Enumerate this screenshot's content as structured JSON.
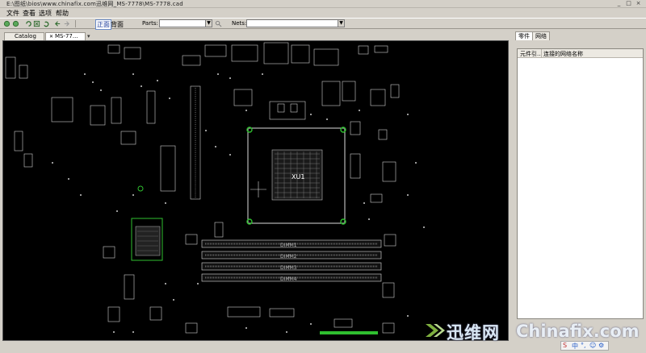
{
  "window": {
    "title": "E:\\图纸\\bios\\www.chinafix.com迅维网_MS-7778\\MS-7778.cad",
    "controls": [
      "_",
      "□",
      "×"
    ]
  },
  "menu": [
    "文件",
    "查看",
    "选项",
    "帮助"
  ],
  "toolbar": {
    "mode_active": "正面",
    "mode_other": "背面",
    "parts_label": "Parts:",
    "parts_value": "",
    "nets_label": "Nets:",
    "nets_value": ""
  },
  "tabs": [
    {
      "label": "Catalog",
      "active": false
    },
    {
      "label": "MS-77...",
      "active": true
    }
  ],
  "canvas": {
    "background": "#000000",
    "dimm_labels": [
      "DIMM1",
      "DIMM2",
      "DIMM3",
      "DIMM4"
    ],
    "cpu_label": "XU1",
    "pcb_outline_color": "#dddddd",
    "highlight_color": "#2fbf2f"
  },
  "panel": {
    "tabs": [
      "零件",
      "网络"
    ],
    "active_tab": "零件",
    "columns": [
      "元件引...",
      "连接的网络名称"
    ]
  },
  "watermark": {
    "cn": "迅维网",
    "en": "Chinafix.com"
  },
  "status_icons": [
    "S",
    "中",
    "°,",
    "☺",
    "⚙"
  ]
}
